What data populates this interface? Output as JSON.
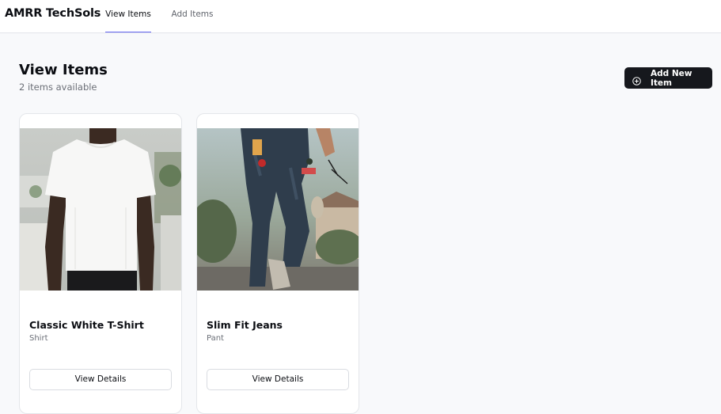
{
  "nav": {
    "brand": "AMRR TechSols",
    "tabs": [
      {
        "label": "View Items",
        "active": true
      },
      {
        "label": "Add Items",
        "active": false
      }
    ]
  },
  "header": {
    "title": "View Items",
    "subtitle": "2 items available",
    "add_button_label": "Add New Item",
    "add_button_icon": "plus-circle-icon"
  },
  "items": [
    {
      "name": "Classic White T-Shirt",
      "category": "Shirt",
      "button_label": "View Details",
      "image": "white-tshirt-photo"
    },
    {
      "name": "Slim Fit Jeans",
      "category": "Pant",
      "button_label": "View Details",
      "image": "ripped-jeans-photo"
    }
  ],
  "colors": {
    "accent": "#6366f1",
    "primary_button": "#16181d",
    "background": "#f8f9fb"
  }
}
